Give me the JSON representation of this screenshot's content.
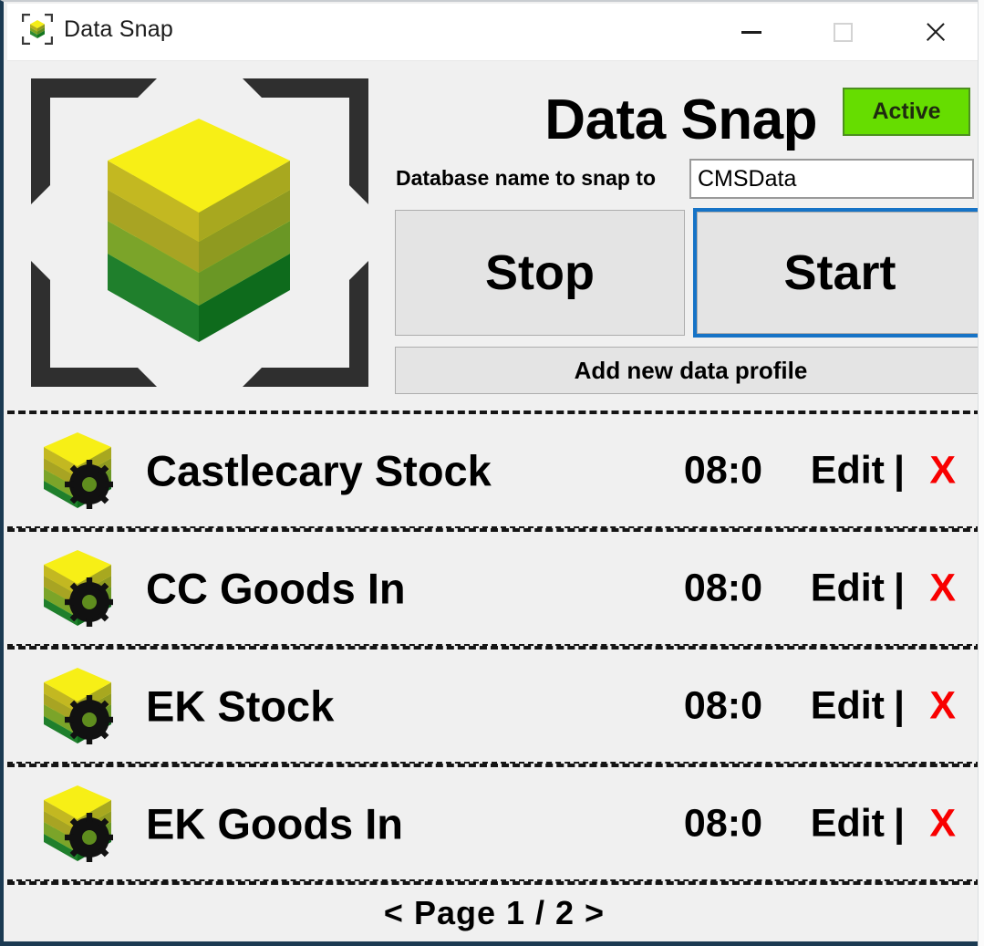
{
  "window": {
    "title": "Data Snap",
    "app_icon": "data-snap-cube-icon",
    "controls": {
      "minimize": "minimize-icon",
      "maximize": "maximize-icon",
      "close": "close-icon"
    }
  },
  "header": {
    "logo_icon": "stacked-cube-scan-icon",
    "app_title": "Data Snap",
    "status": {
      "label": "Active",
      "bg_color": "#66DD00",
      "border_color": "#4C8F1F"
    },
    "database": {
      "label": "Database name to snap to",
      "value": "CMSData",
      "placeholder": "Database name"
    },
    "buttons": {
      "stop": "Stop",
      "start": "Start",
      "add_profile": "Add new data profile"
    },
    "focus_color": "#1673C6"
  },
  "list": {
    "columns": [
      "icon",
      "name",
      "time",
      "edit",
      "separator",
      "delete"
    ],
    "edit_label": "Edit",
    "separator_label": "|",
    "delete_label": "X",
    "delete_color": "#F80000",
    "rows": [
      {
        "icon": "cube-gear-icon",
        "name": "Castlecary Stock",
        "time": "08:0"
      },
      {
        "icon": "cube-gear-icon",
        "name": "CC Goods In",
        "time": "08:0"
      },
      {
        "icon": "cube-gear-icon",
        "name": "EK Stock",
        "time": "08:0"
      },
      {
        "icon": "cube-gear-icon",
        "name": "EK Goods In",
        "time": "08:0"
      }
    ]
  },
  "pager": {
    "text": "< Page 1 / 2 >",
    "prev_label": "<",
    "next_label": ">",
    "current_page": 1,
    "total_pages": 2
  }
}
